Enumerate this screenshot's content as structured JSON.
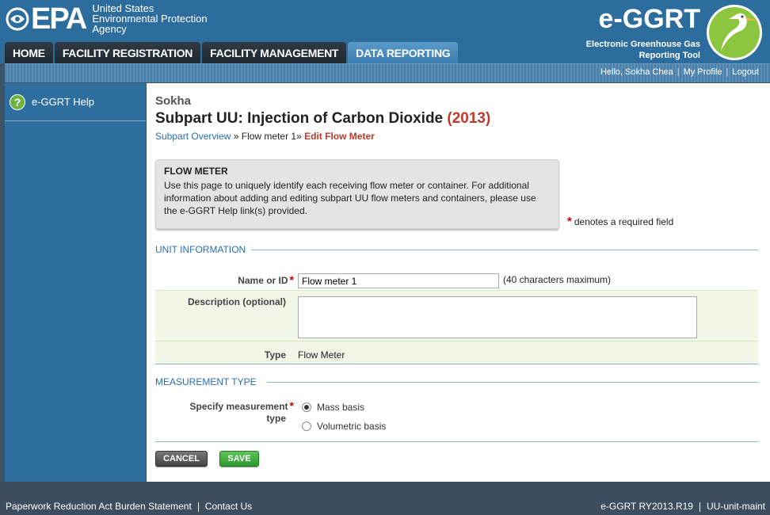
{
  "header": {
    "epa_logo_text": "EPA",
    "agency_lines": [
      "United States",
      "Environmental Protection",
      "Agency"
    ],
    "app_name": "e-GGRT",
    "app_subtitle_lines": [
      "Electronic Greenhouse Gas",
      "Reporting Tool"
    ]
  },
  "nav": {
    "tabs": [
      {
        "label": "HOME",
        "active": false
      },
      {
        "label": "FACILITY REGISTRATION",
        "active": false
      },
      {
        "label": "FACILITY MANAGEMENT",
        "active": false
      },
      {
        "label": "DATA REPORTING",
        "active": true
      }
    ]
  },
  "user_links": {
    "greeting": "Hello, Sokha Chea",
    "profile": "My Profile",
    "logout": "Logout"
  },
  "sidebar": {
    "help_label": "e-GGRT Help",
    "help_icon": "question-icon"
  },
  "main": {
    "facility": "Sokha",
    "title": "Subpart UU: Injection of Carbon Dioxide",
    "year": "(2013)",
    "breadcrumb": {
      "link": "Subpart Overview",
      "sep": "»",
      "item": "Flow meter 1",
      "sep2": "»",
      "current": "Edit Flow Meter"
    },
    "infobox": {
      "title": "FLOW METER",
      "body": "Use this page to uniquely identify each receiving flow meter or container. For additional information about adding and editing subpart UU flow meters and containers, please use the e-GGRT Help link(s) provided."
    },
    "required_note": "denotes a required field",
    "required_mark": "*",
    "unit_section": "UNIT INFORMATION",
    "name_label": "Name or ID",
    "name_value": "Flow meter 1",
    "name_hint": "(40 characters maximum)",
    "desc_label": "Description (optional)",
    "desc_value": "",
    "type_label": "Type",
    "type_value": "Flow Meter",
    "meas_section": "MEASUREMENT TYPE",
    "meas_label_1": "Specify measurement",
    "meas_label_2": "type",
    "meas_options": [
      {
        "label": "Mass basis",
        "selected": true
      },
      {
        "label": "Volumetric basis",
        "selected": false
      }
    ],
    "cancel_label": "CANCEL",
    "save_label": "SAVE"
  },
  "footer": {
    "paperwork": "Paperwork Reduction Act Burden Statement",
    "contact": "Contact Us",
    "version": "e-GGRT RY2013.R19",
    "page_id": "UU-unit-maint"
  },
  "colors": {
    "header_blue": "#2d6d9d",
    "active_tab": "#3c7db0",
    "required_red": "#cc0000",
    "save_green": "#2c9a2c"
  }
}
